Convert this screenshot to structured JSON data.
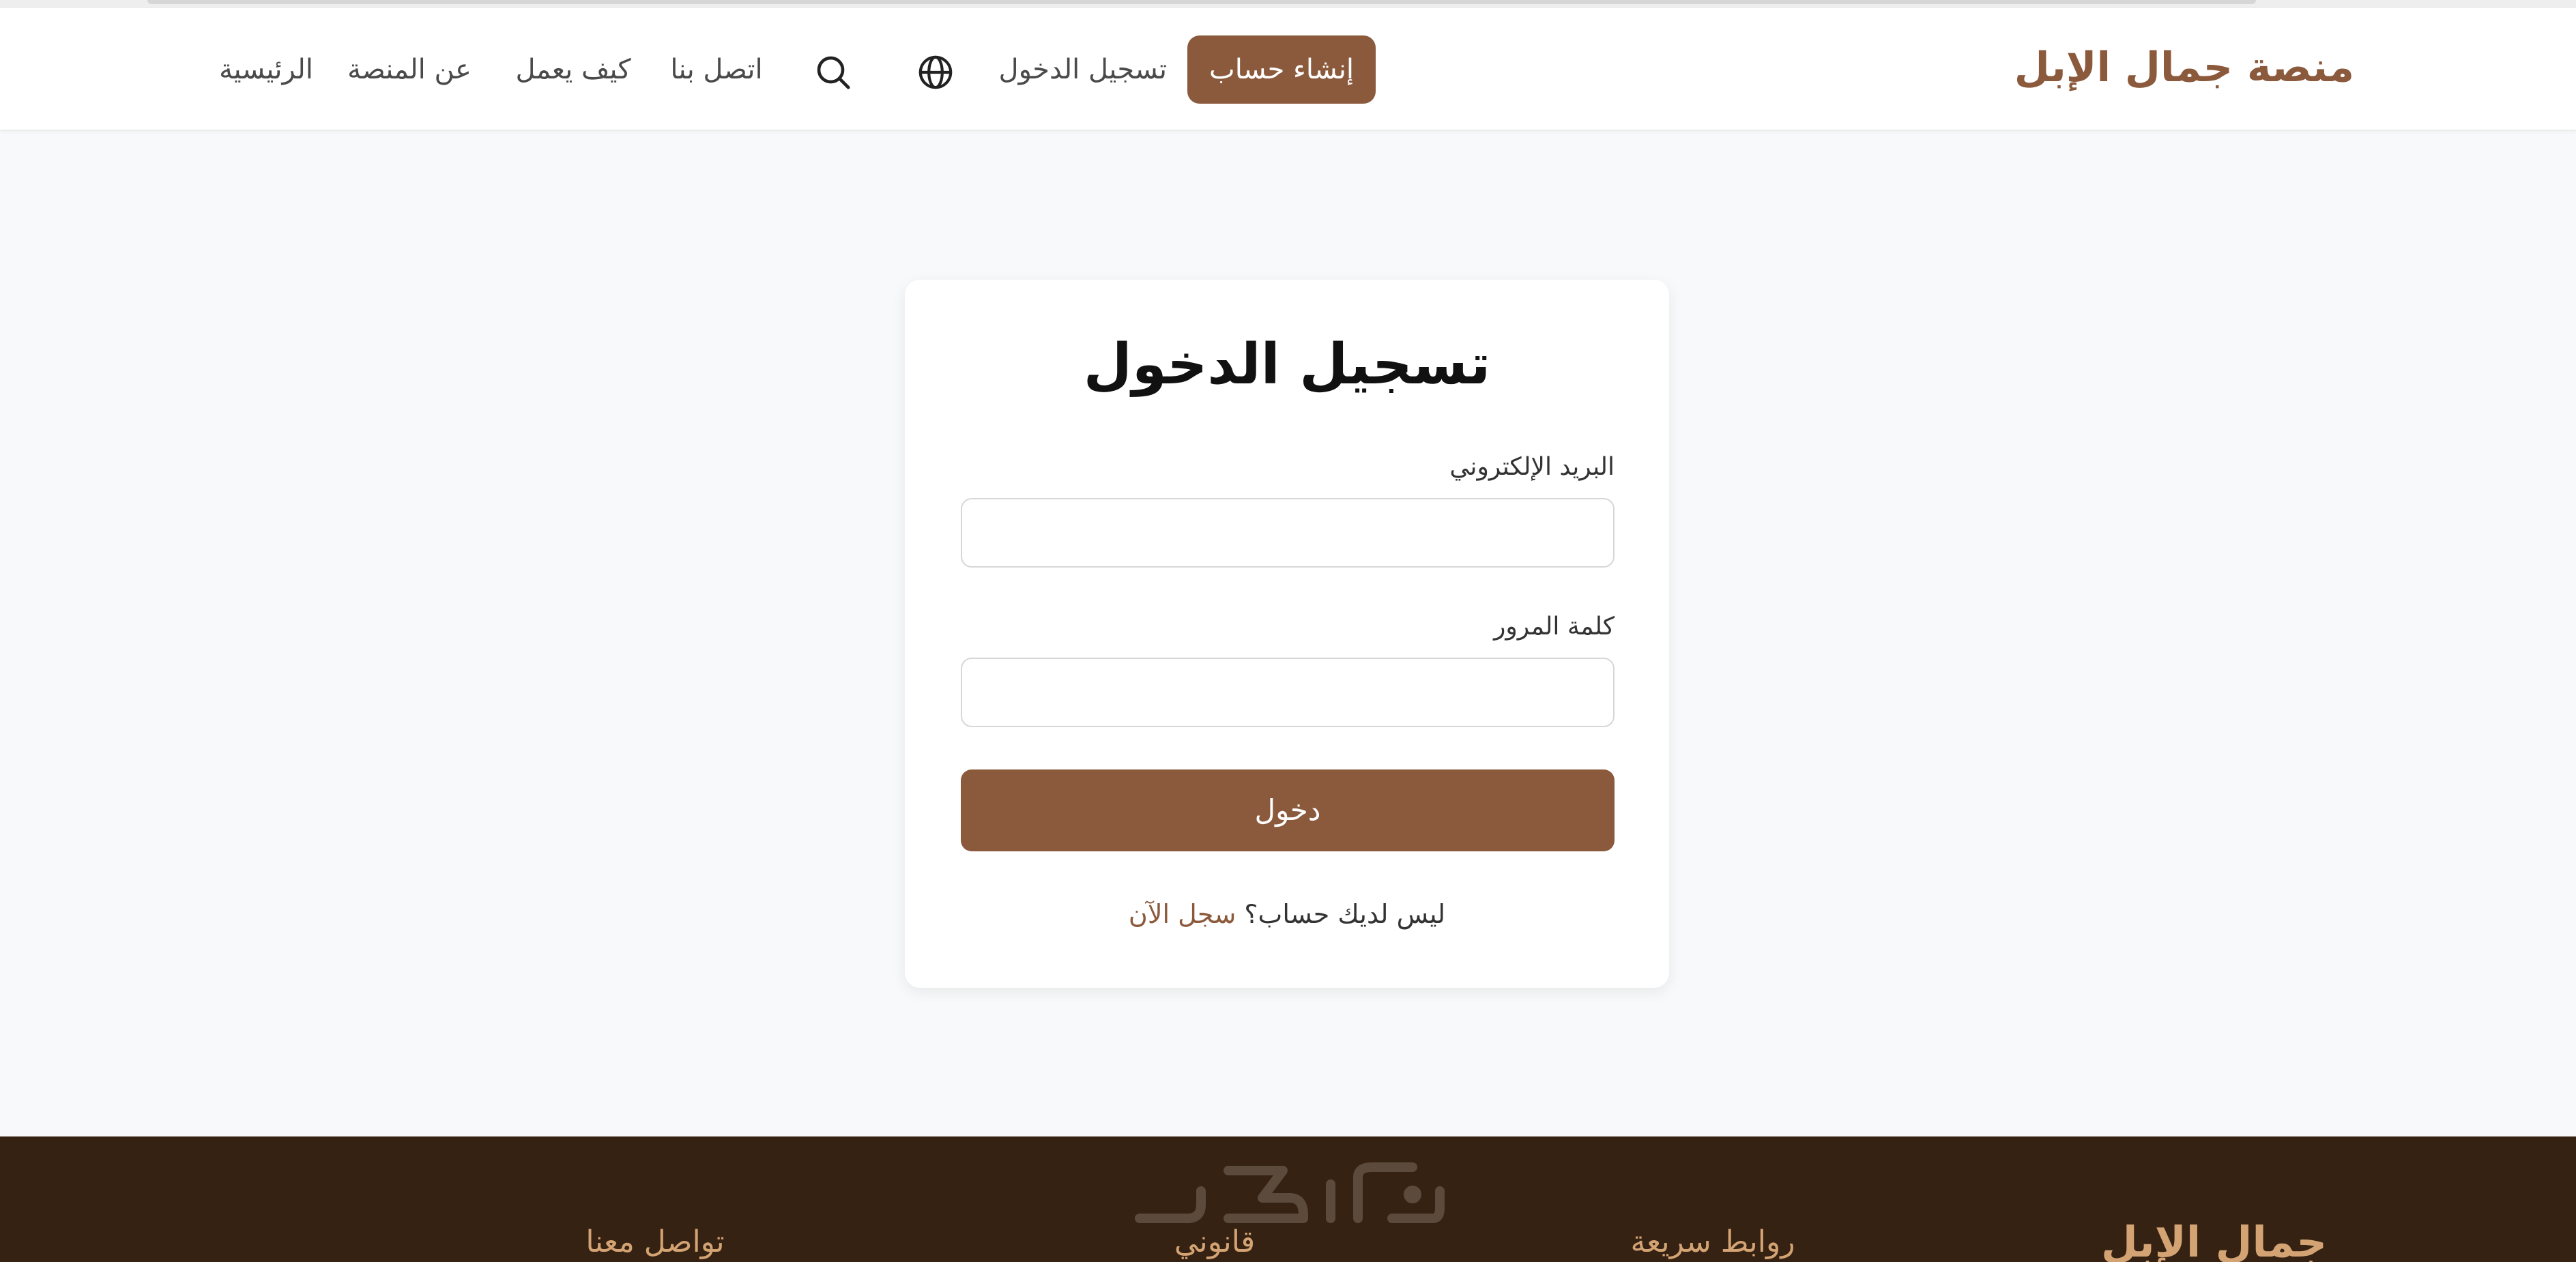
{
  "header": {
    "brand": "منصة جمال الإبل",
    "signup_label": "إنشاء حساب",
    "login_label": "تسجيل الدخول",
    "globe_icon": "globe-icon",
    "search_icon": "search-icon",
    "nav": {
      "contact": "اتصل بنا",
      "how": "كيف يعمل",
      "about": "عن المنصة",
      "home": "الرئيسية"
    }
  },
  "login": {
    "title": "تسجيل الدخول",
    "email_label": "البريد الإلكتروني",
    "email_value": "",
    "password_label": "كلمة المرور",
    "password_value": "",
    "submit_label": "دخول",
    "no_account_text": "ليس لديك حساب؟",
    "register_label": "سجل الآن"
  },
  "footer": {
    "brand": "جمال الإبل",
    "quick_links": "روابط سريعة",
    "legal": "قانوني",
    "contact": "تواصل معنا"
  },
  "colors": {
    "accent": "#8b5a3c",
    "page_background": "#f8f9fa",
    "footer_background": "#352213",
    "footer_text": "#d4a373"
  }
}
